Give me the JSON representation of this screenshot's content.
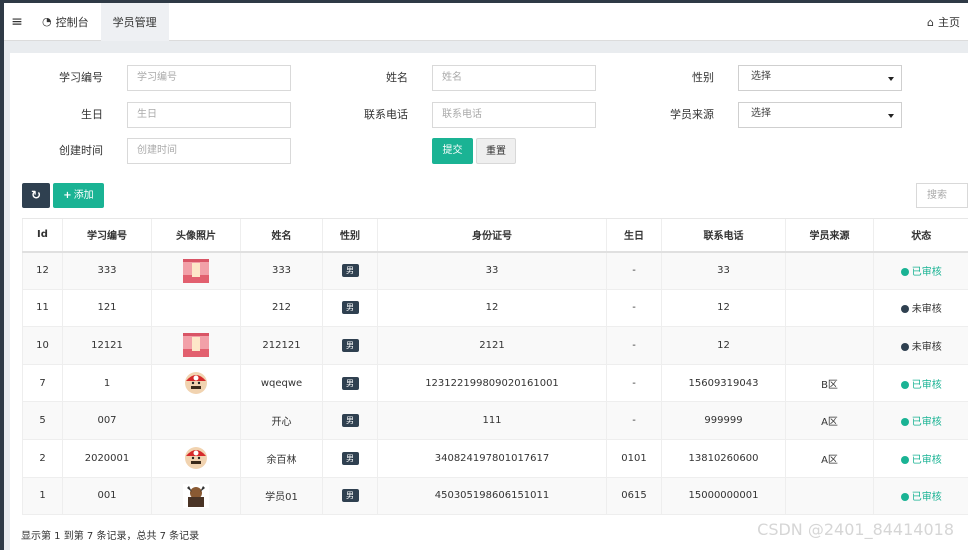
{
  "topbar": {
    "menu_icon": "hamburger-icon",
    "tabs": [
      {
        "icon": "dashboard-icon",
        "label": "控制台"
      },
      {
        "label": "学员管理"
      }
    ],
    "home_label": "主页"
  },
  "form": {
    "fields": [
      {
        "label": "学习编号",
        "placeholder": "学习编号"
      },
      {
        "label": "姓名",
        "placeholder": "姓名"
      },
      {
        "label": "性别",
        "value": "选择"
      },
      {
        "label": "生日",
        "placeholder": "生日"
      },
      {
        "label": "联系电话",
        "placeholder": "联系电话"
      },
      {
        "label": "学员来源",
        "value": "选择"
      },
      {
        "label": "创建时间",
        "placeholder": "创建时间"
      }
    ],
    "submit_label": "提交",
    "reset_label": "重置"
  },
  "toolbar": {
    "add_label": "添加",
    "search_placeholder": "搜索"
  },
  "table": {
    "columns": [
      "Id",
      "学习编号",
      "头像照片",
      "姓名",
      "性别",
      "身份证号",
      "生日",
      "联系电话",
      "学员来源",
      "状态"
    ],
    "rows": [
      {
        "id": "12",
        "code": "333",
        "avatar": "pink",
        "name": "333",
        "gender": "男",
        "idcard": "33",
        "birthday": "-",
        "phone": "33",
        "source": "",
        "status": "已审核"
      },
      {
        "id": "11",
        "code": "121",
        "avatar": "",
        "name": "212",
        "gender": "男",
        "idcard": "12",
        "birthday": "-",
        "phone": "12",
        "source": "",
        "status": "未审核"
      },
      {
        "id": "10",
        "code": "12121",
        "avatar": "pink",
        "name": "212121",
        "gender": "男",
        "idcard": "2121",
        "birthday": "-",
        "phone": "12",
        "source": "",
        "status": "未审核"
      },
      {
        "id": "7",
        "code": "1",
        "avatar": "mario",
        "name": "wqeqwe",
        "gender": "男",
        "idcard": "123122199809020161001",
        "birthday": "-",
        "phone": "15609319043",
        "source": "B区",
        "status": "已审核"
      },
      {
        "id": "5",
        "code": "007",
        "avatar": "",
        "name": "开心",
        "gender": "男",
        "idcard": "111",
        "birthday": "-",
        "phone": "999999",
        "source": "A区",
        "status": "已审核"
      },
      {
        "id": "2",
        "code": "2020001",
        "avatar": "mario",
        "name": "余百林",
        "gender": "男",
        "idcard": "340824197801017617",
        "birthday": "0101",
        "phone": "13810260600",
        "source": "A区",
        "status": "已审核"
      },
      {
        "id": "1",
        "code": "001",
        "avatar": "warrior",
        "name": "学员01",
        "gender": "男",
        "idcard": "450305198606151011",
        "birthday": "0615",
        "phone": "15000000001",
        "source": "",
        "status": "已审核"
      }
    ]
  },
  "footer": {
    "info": "显示第 1 到第 7 条记录，总共 7 条记录"
  },
  "watermark": "CSDN @2401_84414018",
  "colors": {
    "accent": "#1ab394",
    "dark": "#2f4050"
  }
}
